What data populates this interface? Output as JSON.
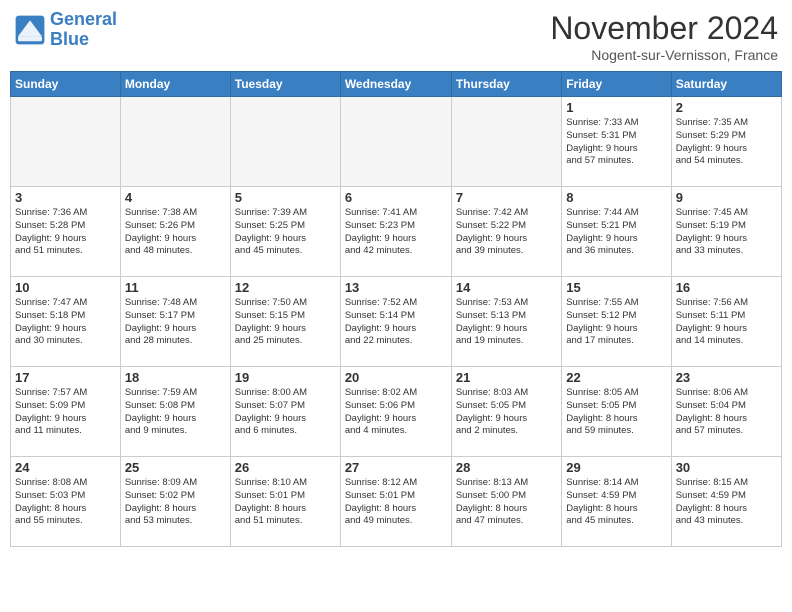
{
  "header": {
    "logo_line1": "General",
    "logo_line2": "Blue",
    "month": "November 2024",
    "location": "Nogent-sur-Vernisson, France"
  },
  "days_of_week": [
    "Sunday",
    "Monday",
    "Tuesday",
    "Wednesday",
    "Thursday",
    "Friday",
    "Saturday"
  ],
  "weeks": [
    [
      {
        "day": "",
        "info": ""
      },
      {
        "day": "",
        "info": ""
      },
      {
        "day": "",
        "info": ""
      },
      {
        "day": "",
        "info": ""
      },
      {
        "day": "",
        "info": ""
      },
      {
        "day": "1",
        "info": "Sunrise: 7:33 AM\nSunset: 5:31 PM\nDaylight: 9 hours\nand 57 minutes."
      },
      {
        "day": "2",
        "info": "Sunrise: 7:35 AM\nSunset: 5:29 PM\nDaylight: 9 hours\nand 54 minutes."
      }
    ],
    [
      {
        "day": "3",
        "info": "Sunrise: 7:36 AM\nSunset: 5:28 PM\nDaylight: 9 hours\nand 51 minutes."
      },
      {
        "day": "4",
        "info": "Sunrise: 7:38 AM\nSunset: 5:26 PM\nDaylight: 9 hours\nand 48 minutes."
      },
      {
        "day": "5",
        "info": "Sunrise: 7:39 AM\nSunset: 5:25 PM\nDaylight: 9 hours\nand 45 minutes."
      },
      {
        "day": "6",
        "info": "Sunrise: 7:41 AM\nSunset: 5:23 PM\nDaylight: 9 hours\nand 42 minutes."
      },
      {
        "day": "7",
        "info": "Sunrise: 7:42 AM\nSunset: 5:22 PM\nDaylight: 9 hours\nand 39 minutes."
      },
      {
        "day": "8",
        "info": "Sunrise: 7:44 AM\nSunset: 5:21 PM\nDaylight: 9 hours\nand 36 minutes."
      },
      {
        "day": "9",
        "info": "Sunrise: 7:45 AM\nSunset: 5:19 PM\nDaylight: 9 hours\nand 33 minutes."
      }
    ],
    [
      {
        "day": "10",
        "info": "Sunrise: 7:47 AM\nSunset: 5:18 PM\nDaylight: 9 hours\nand 30 minutes."
      },
      {
        "day": "11",
        "info": "Sunrise: 7:48 AM\nSunset: 5:17 PM\nDaylight: 9 hours\nand 28 minutes."
      },
      {
        "day": "12",
        "info": "Sunrise: 7:50 AM\nSunset: 5:15 PM\nDaylight: 9 hours\nand 25 minutes."
      },
      {
        "day": "13",
        "info": "Sunrise: 7:52 AM\nSunset: 5:14 PM\nDaylight: 9 hours\nand 22 minutes."
      },
      {
        "day": "14",
        "info": "Sunrise: 7:53 AM\nSunset: 5:13 PM\nDaylight: 9 hours\nand 19 minutes."
      },
      {
        "day": "15",
        "info": "Sunrise: 7:55 AM\nSunset: 5:12 PM\nDaylight: 9 hours\nand 17 minutes."
      },
      {
        "day": "16",
        "info": "Sunrise: 7:56 AM\nSunset: 5:11 PM\nDaylight: 9 hours\nand 14 minutes."
      }
    ],
    [
      {
        "day": "17",
        "info": "Sunrise: 7:57 AM\nSunset: 5:09 PM\nDaylight: 9 hours\nand 11 minutes."
      },
      {
        "day": "18",
        "info": "Sunrise: 7:59 AM\nSunset: 5:08 PM\nDaylight: 9 hours\nand 9 minutes."
      },
      {
        "day": "19",
        "info": "Sunrise: 8:00 AM\nSunset: 5:07 PM\nDaylight: 9 hours\nand 6 minutes."
      },
      {
        "day": "20",
        "info": "Sunrise: 8:02 AM\nSunset: 5:06 PM\nDaylight: 9 hours\nand 4 minutes."
      },
      {
        "day": "21",
        "info": "Sunrise: 8:03 AM\nSunset: 5:05 PM\nDaylight: 9 hours\nand 2 minutes."
      },
      {
        "day": "22",
        "info": "Sunrise: 8:05 AM\nSunset: 5:05 PM\nDaylight: 8 hours\nand 59 minutes."
      },
      {
        "day": "23",
        "info": "Sunrise: 8:06 AM\nSunset: 5:04 PM\nDaylight: 8 hours\nand 57 minutes."
      }
    ],
    [
      {
        "day": "24",
        "info": "Sunrise: 8:08 AM\nSunset: 5:03 PM\nDaylight: 8 hours\nand 55 minutes."
      },
      {
        "day": "25",
        "info": "Sunrise: 8:09 AM\nSunset: 5:02 PM\nDaylight: 8 hours\nand 53 minutes."
      },
      {
        "day": "26",
        "info": "Sunrise: 8:10 AM\nSunset: 5:01 PM\nDaylight: 8 hours\nand 51 minutes."
      },
      {
        "day": "27",
        "info": "Sunrise: 8:12 AM\nSunset: 5:01 PM\nDaylight: 8 hours\nand 49 minutes."
      },
      {
        "day": "28",
        "info": "Sunrise: 8:13 AM\nSunset: 5:00 PM\nDaylight: 8 hours\nand 47 minutes."
      },
      {
        "day": "29",
        "info": "Sunrise: 8:14 AM\nSunset: 4:59 PM\nDaylight: 8 hours\nand 45 minutes."
      },
      {
        "day": "30",
        "info": "Sunrise: 8:15 AM\nSunset: 4:59 PM\nDaylight: 8 hours\nand 43 minutes."
      }
    ]
  ]
}
